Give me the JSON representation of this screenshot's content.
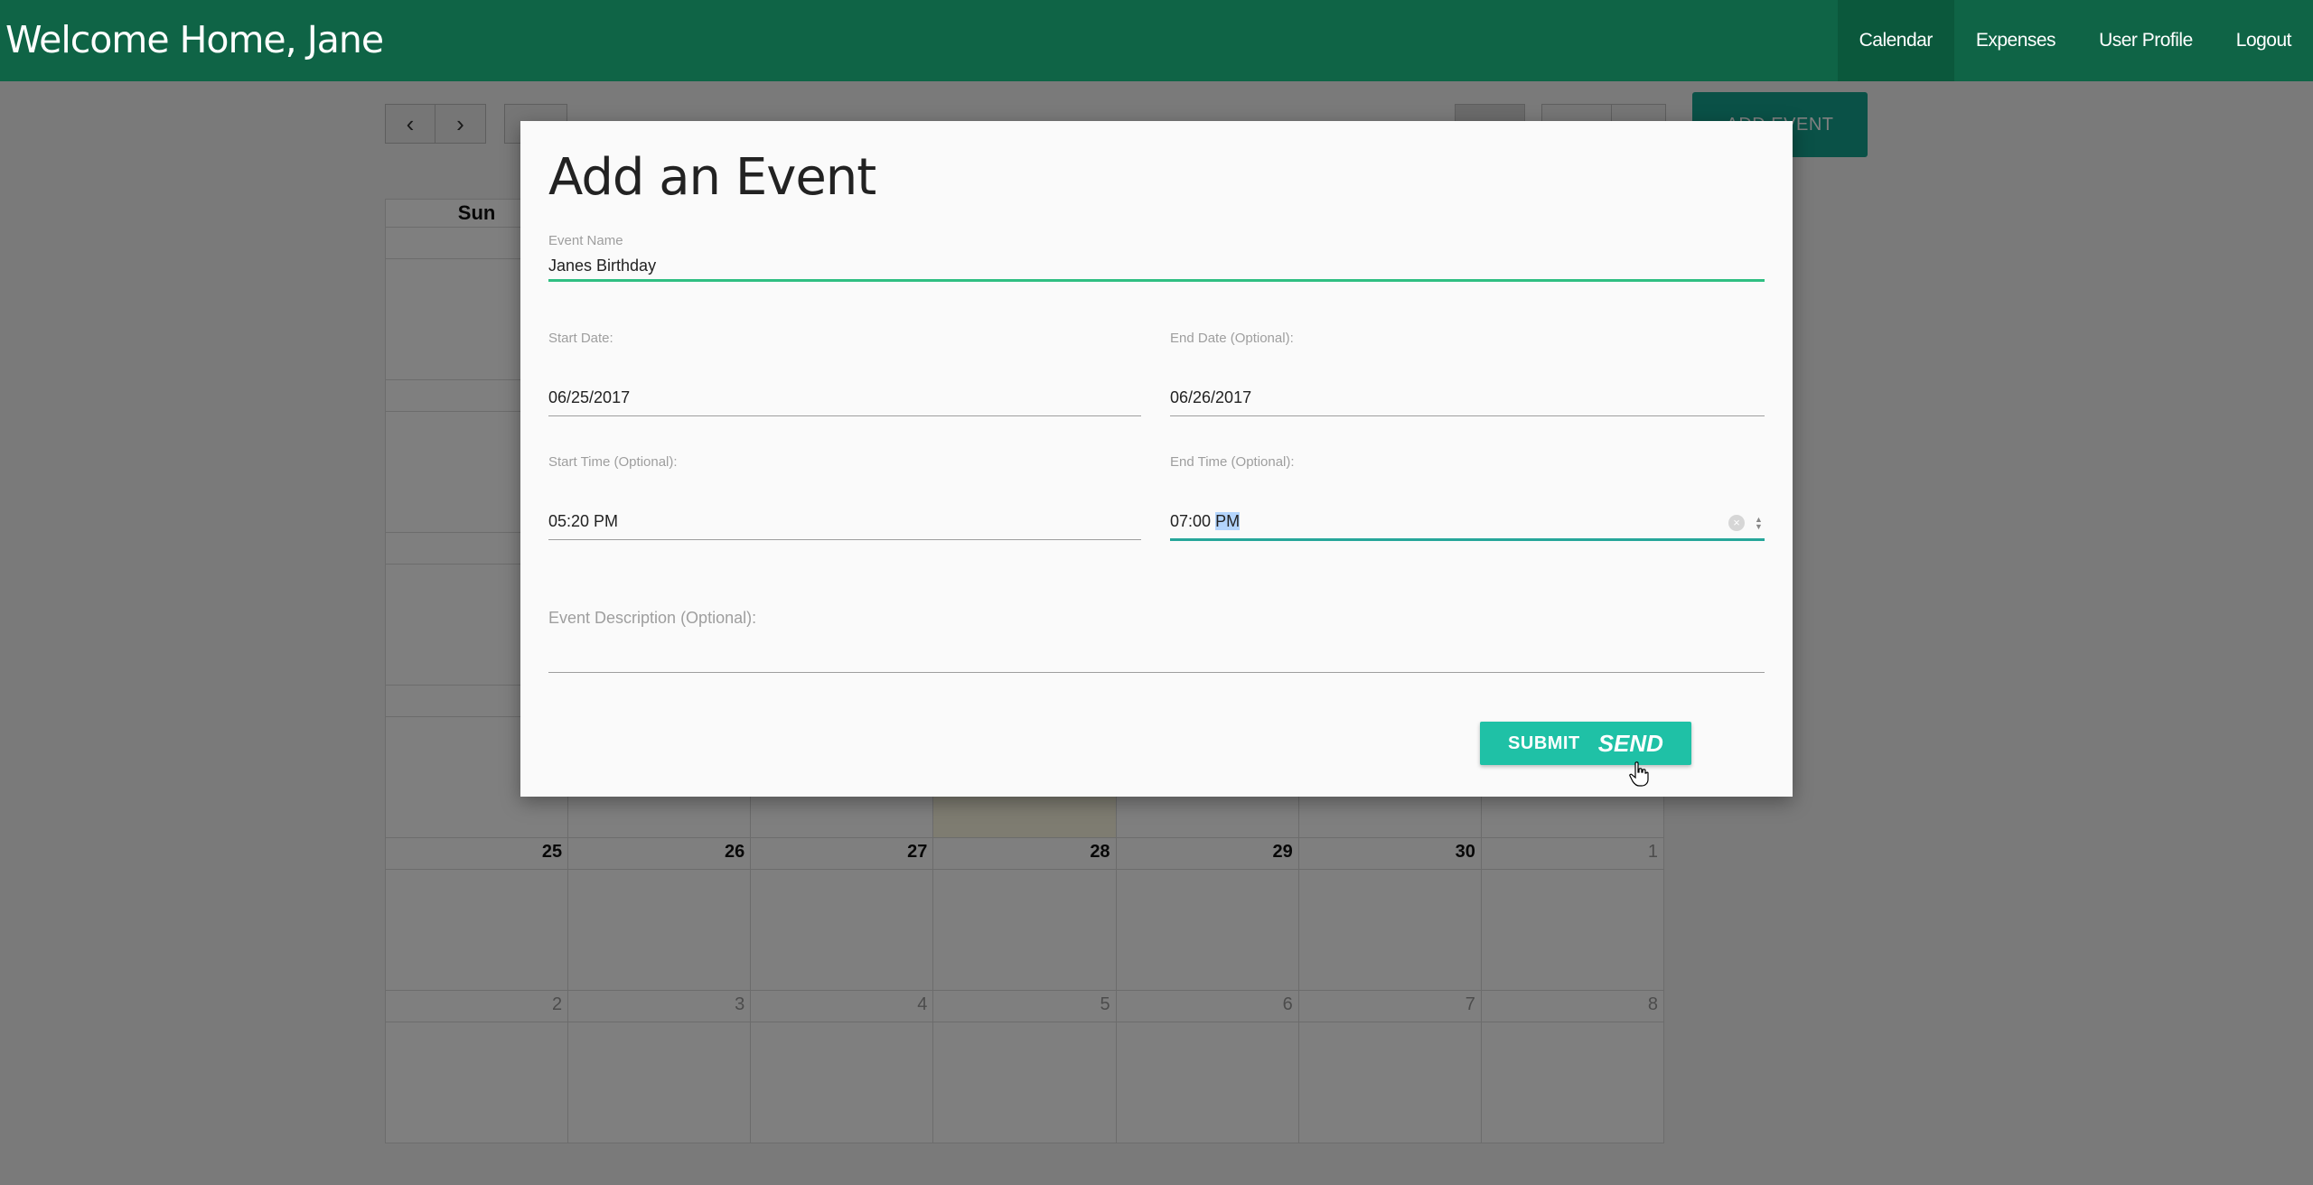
{
  "navbar": {
    "brand": "Welcome Home, Jane",
    "links": [
      {
        "label": "Calendar",
        "active": true
      },
      {
        "label": "Expenses"
      },
      {
        "label": "User Profile"
      },
      {
        "label": "Logout"
      }
    ]
  },
  "calendar": {
    "prev_icon": "chevron-left-icon",
    "next_icon": "chevron-right-icon",
    "add_event_label": "ADD EVENT",
    "weekday_header": "Sun",
    "weeks": [
      [
        "25",
        "26",
        "27",
        "28",
        "29",
        "30",
        "1"
      ],
      [
        "2",
        "3",
        "4",
        "5",
        "6",
        "7",
        "8"
      ]
    ]
  },
  "modal": {
    "title": "Add an Event",
    "event_name": {
      "label": "Event Name",
      "value": "Janes Birthday"
    },
    "start_date": {
      "label": "Start Date:",
      "value": "06/25/2017"
    },
    "end_date": {
      "label": "End Date (Optional):",
      "value": "06/26/2017"
    },
    "start_time": {
      "label": "Start Time (Optional):",
      "value": "05:20 PM"
    },
    "end_time": {
      "label": "End Time (Optional):",
      "value_time": "07:00",
      "value_ampm": "PM"
    },
    "description": {
      "label": "Event Description (Optional):",
      "value": ""
    },
    "submit_label": "SUBMIT",
    "send_label": "SEND"
  },
  "colors": {
    "navbar": "#0f6446",
    "accent": "#26a69a",
    "submit": "#1fc1a6"
  }
}
